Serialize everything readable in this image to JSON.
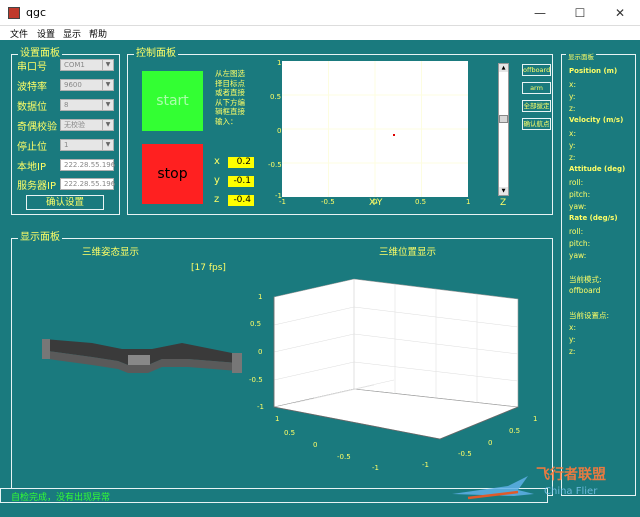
{
  "window": {
    "title": "qgc",
    "minimize": "—",
    "maximize": "☐",
    "close": "✕"
  },
  "menu": [
    "文件",
    "设置",
    "显示",
    "帮助"
  ],
  "settings_panel": {
    "title": "设置面板",
    "fields": [
      {
        "label": "串口号",
        "value": "COM1"
      },
      {
        "label": "波特率",
        "value": "9600"
      },
      {
        "label": "数据位",
        "value": "8"
      },
      {
        "label": "奇偶校验",
        "value": "无校验"
      },
      {
        "label": "停止位",
        "value": "1"
      }
    ],
    "local_ip_label": "本地IP",
    "local_ip": "222.28.55.196",
    "server_ip_label": "服务器IP",
    "server_ip": "222.28.55.196",
    "confirm_button": "确认设置"
  },
  "control_panel": {
    "title": "控制面板",
    "start_button": "start",
    "stop_button": "stop",
    "hint": [
      "从左图选",
      "择目标点",
      "或者直接",
      "从下方编",
      "辑框直接",
      "输入："
    ],
    "x_label": "x",
    "x_value": "0.2",
    "y_label": "y",
    "y_value": "-0.1",
    "z_label": "z",
    "z_value": "-0.4",
    "plot": {
      "xlabel": "X-Y",
      "xticks": [
        "-1",
        "-0.5",
        "0",
        "0.5",
        "1"
      ],
      "yticks": [
        "1",
        "0.5",
        "0",
        "-0.5",
        "-1"
      ]
    },
    "z_label_slider": "Z",
    "z_slider_level": 0.6,
    "buttons": [
      "offboard",
      "arm",
      "全部拔定",
      "确认航点"
    ]
  },
  "status_panel": {
    "title": "显示面板",
    "position_title": "Position (m)",
    "velocity_title": "Velocity (m/s)",
    "attitude_title": "Attitude (deg)",
    "rate_title": "Rate (deg/s)",
    "xyz": [
      "x:",
      "y:",
      "z:"
    ],
    "attitude": [
      "roll:",
      "pitch:",
      "yaw:"
    ],
    "mode_title": "当前模式:",
    "mode_value": "offboard",
    "setpoint_title": "当前设置点:"
  },
  "display_panel": {
    "title": "显示面板",
    "attitude_title": "三维姿态显示",
    "fps": "[17 fps]",
    "position_title": "三维位置显示",
    "zticks": [
      "1",
      "0.5",
      "0",
      "-0.5",
      "-1"
    ],
    "left_axis_ticks": [
      "1",
      "0.5",
      "0",
      "-0.5",
      "-1"
    ],
    "right_axis_ticks": [
      "-1",
      "-0.5",
      "0",
      "0.5",
      "1"
    ]
  },
  "status_bar": "自检完成，没有出现异常",
  "watermark": {
    "cn": "飞行者联盟",
    "en": "China Flier"
  }
}
